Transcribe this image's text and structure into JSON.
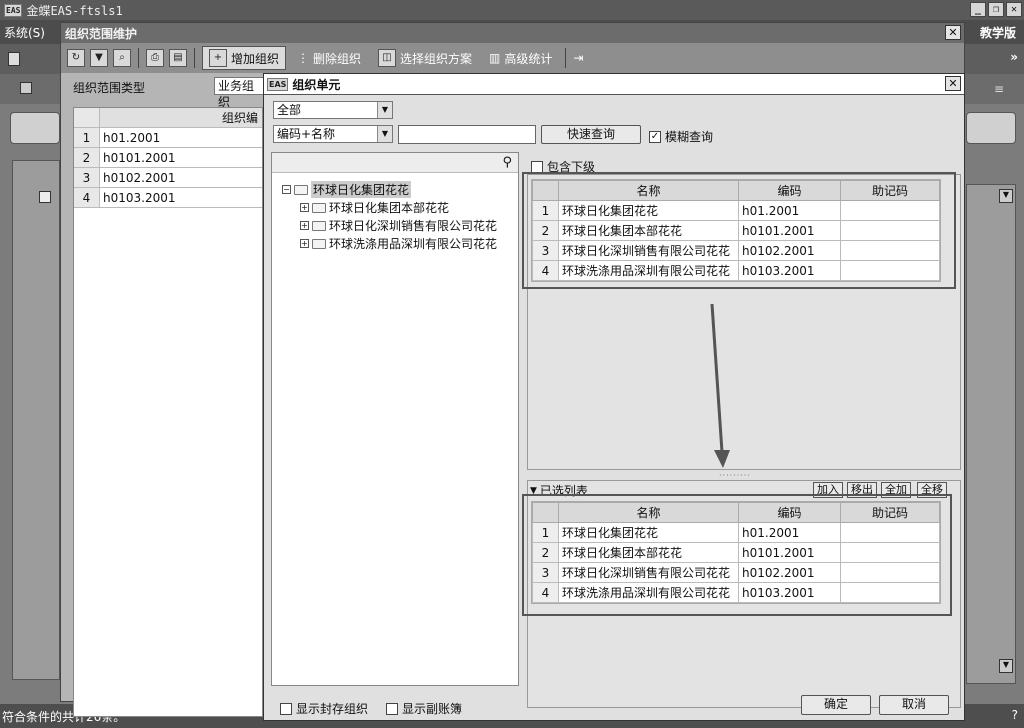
{
  "app": {
    "title": "金蝶EAS-ftsls1",
    "menu_item": "系统(S)",
    "edition": "教学版",
    "status_text": "符合条件的共计26条。"
  },
  "maintain_dialog": {
    "title": "组织范围维护",
    "toolbar": {
      "add_org": "增加组织",
      "delete_org": "删除组织",
      "select_scheme": "选择组织方案",
      "advanced_stats": "高级统计"
    },
    "scope_type_label": "组织范围类型",
    "scope_type_value": "业务组织",
    "left_grid": {
      "header": "组织编",
      "rows": [
        {
          "num": "1",
          "code": "h01.2001"
        },
        {
          "num": "2",
          "code": "h0101.2001"
        },
        {
          "num": "3",
          "code": "h0102.2001"
        },
        {
          "num": "4",
          "code": "h0103.2001"
        }
      ]
    }
  },
  "org_dialog": {
    "title": "组织单元",
    "filter_select": "全部",
    "field_select": "编码+名称",
    "search_input_value": "",
    "quick_search": "快速查询",
    "fuzzy_search": "模糊查询",
    "include_children": "包含下级",
    "tree": {
      "root": "环球日化集团花花",
      "children": [
        "环球日化集团本部花花",
        "环球日化深圳销售有限公司花花",
        "环球洗涤用品深圳有限公司花花"
      ]
    },
    "columns": [
      "名称",
      "编码",
      "助记码"
    ],
    "available": [
      {
        "num": "1",
        "name": "环球日化集团花花",
        "code": "h01.2001",
        "mnemonic": ""
      },
      {
        "num": "2",
        "name": "环球日化集团本部花花",
        "code": "h0101.2001",
        "mnemonic": ""
      },
      {
        "num": "3",
        "name": "环球日化深圳销售有限公司花花",
        "code": "h0102.2001",
        "mnemonic": ""
      },
      {
        "num": "4",
        "name": "环球洗涤用品深圳有限公司花花",
        "code": "h0103.2001",
        "mnemonic": ""
      }
    ],
    "selected_list_title": "已选列表",
    "list_buttons": {
      "add": "加入",
      "remove": "移出",
      "add_all": "全加",
      "remove_all": "全移"
    },
    "selected": [
      {
        "num": "1",
        "name": "环球日化集团花花",
        "code": "h01.2001",
        "mnemonic": ""
      },
      {
        "num": "2",
        "name": "环球日化集团本部花花",
        "code": "h0101.2001",
        "mnemonic": ""
      },
      {
        "num": "3",
        "name": "环球日化深圳销售有限公司花花",
        "code": "h0102.2001",
        "mnemonic": ""
      },
      {
        "num": "4",
        "name": "环球洗涤用品深圳有限公司花花",
        "code": "h0103.2001",
        "mnemonic": ""
      }
    ],
    "show_sealed": "显示封存组织",
    "show_sub_ledger": "显示副账簿",
    "ok": "确定",
    "cancel": "取消"
  }
}
